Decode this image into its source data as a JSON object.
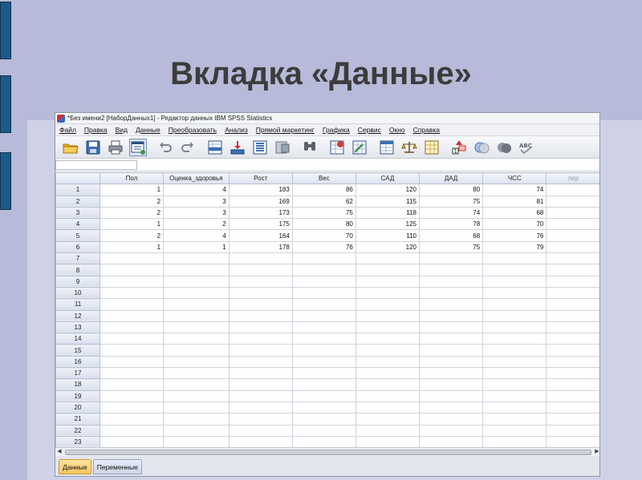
{
  "slide": {
    "title": "Вкладка «Данные»"
  },
  "window": {
    "title": "*Без имени2 [НаборДанных1] - Редактор данных IBM SPSS Statistics"
  },
  "menu": [
    "Файл",
    "Правка",
    "Вид",
    "Данные",
    "Преобразовать",
    "Анализ",
    "Прямой маркетинг",
    "Графика",
    "Сервис",
    "Окно",
    "Справка"
  ],
  "toolbar": {
    "icons": [
      "open-folder-icon",
      "save-icon",
      "print-icon",
      "dialog-recall-icon",
      "undo-icon",
      "redo-icon",
      "goto-case-icon",
      "goto-variable-icon",
      "variables-icon",
      "run-descriptives-icon",
      "find-icon",
      "insert-cases-icon",
      "insert-variable-icon",
      "split-file-icon",
      "weight-cases-icon",
      "select-cases-icon",
      "value-labels-icon",
      "use-sets-icon",
      "show-all-variables-icon",
      "spell-check-icon"
    ]
  },
  "grid": {
    "columns": [
      "Пол",
      "Оценка_здоровья",
      "Рост",
      "Вес",
      "САД",
      "ДАД",
      "ЧСС",
      "пер"
    ],
    "rows": [
      [
        "1",
        "4",
        "183",
        "86",
        "120",
        "80",
        "74",
        ""
      ],
      [
        "2",
        "3",
        "169",
        "62",
        "115",
        "75",
        "81",
        ""
      ],
      [
        "2",
        "3",
        "173",
        "75",
        "118",
        "74",
        "68",
        ""
      ],
      [
        "1",
        "2",
        "175",
        "80",
        "125",
        "78",
        "70",
        ""
      ],
      [
        "2",
        "4",
        "164",
        "70",
        "110",
        "68",
        "76",
        ""
      ],
      [
        "1",
        "1",
        "178",
        "76",
        "120",
        "75",
        "79",
        ""
      ]
    ],
    "row_count": 23
  },
  "tabs": [
    "Данные",
    "Переменные"
  ],
  "colors": {
    "slide_bg": "#b7bad8",
    "side_bar": "#1d5a86",
    "active_tab": "#f4c55d"
  }
}
